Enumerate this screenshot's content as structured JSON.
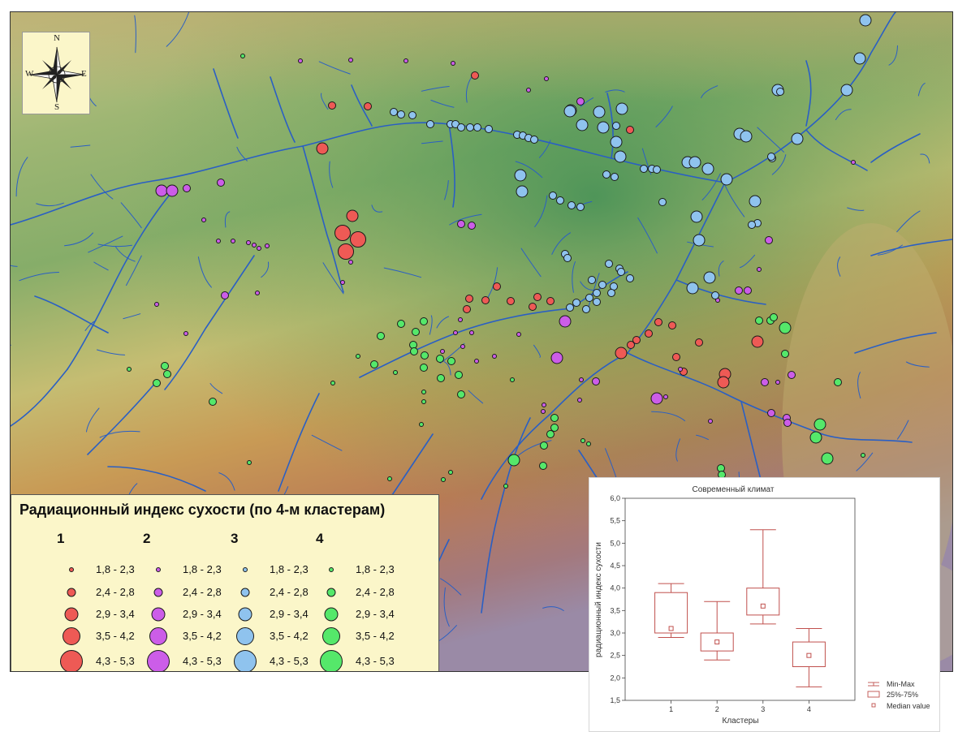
{
  "map": {
    "compass": {
      "n": "N",
      "s": "S",
      "e": "E",
      "w": "W"
    },
    "colors": {
      "cluster1": "#ee5a55",
      "cluster2": "#cc5de8",
      "cluster3": "#8fc3ee",
      "cluster4": "#55e86a",
      "river": "#2a5fc4"
    }
  },
  "legend": {
    "title": "Радиационный индекс сухости (по 4-м кластерам)",
    "clusters": [
      "1",
      "2",
      "3",
      "4"
    ],
    "ranges": [
      "1,8 - 2,3",
      "2,4 - 2,8",
      "2,9 - 3,4",
      "3,5 - 4,2",
      "4,3 - 5,3"
    ]
  },
  "chart_data": {
    "type": "boxplot",
    "title": "Современный климат",
    "xlabel": "Кластеры",
    "ylabel": "радиационный индекс сухости",
    "categories": [
      "1",
      "2",
      "3",
      "4"
    ],
    "ylim": [
      1.5,
      6.0
    ],
    "yticks": [
      "1,5",
      "2,0",
      "2,5",
      "3,0",
      "3,5",
      "4,0",
      "4,5",
      "5,0",
      "5,5",
      "6,0"
    ],
    "boxes": [
      {
        "cluster": "1",
        "min": 2.9,
        "q1": 3.0,
        "median": 3.1,
        "q3": 3.9,
        "max": 4.1
      },
      {
        "cluster": "2",
        "min": 2.4,
        "q1": 2.6,
        "median": 2.8,
        "q3": 3.0,
        "max": 3.7
      },
      {
        "cluster": "3",
        "min": 3.2,
        "q1": 3.4,
        "median": 3.6,
        "q3": 4.0,
        "max": 5.3
      },
      {
        "cluster": "4",
        "min": 1.8,
        "q1": 2.25,
        "median": 2.5,
        "q3": 2.8,
        "max": 3.1
      }
    ],
    "legend": [
      "Min-Max",
      "25%-75%",
      "Median value"
    ],
    "legend_position": "right",
    "color": "#c0504d"
  }
}
